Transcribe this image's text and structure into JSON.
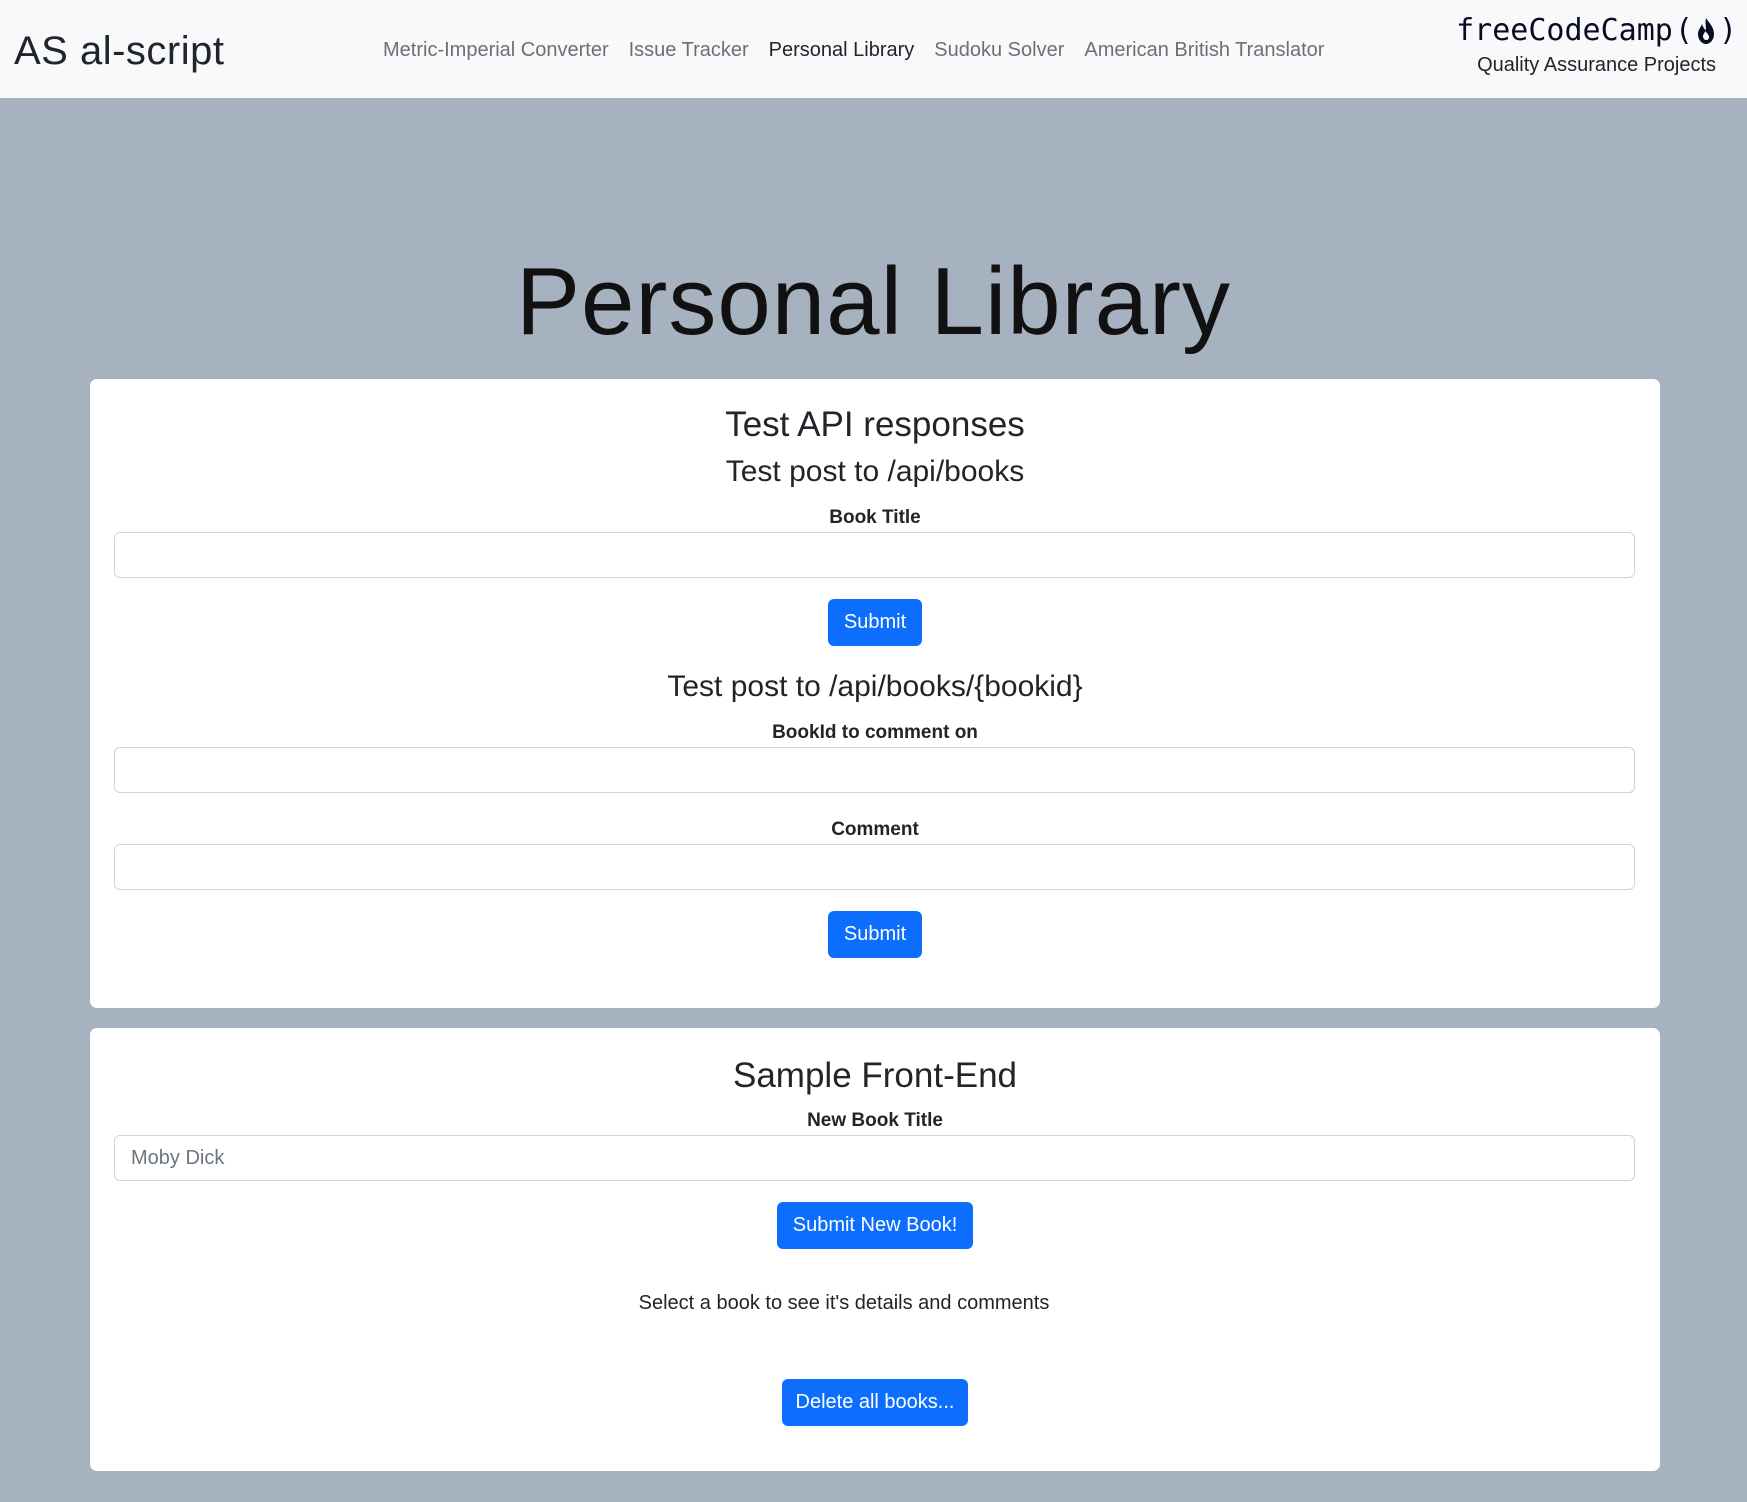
{
  "nav": {
    "brand": "AS al-script",
    "links": [
      {
        "label": "Metric-Imperial Converter",
        "active": false
      },
      {
        "label": "Issue Tracker",
        "active": false
      },
      {
        "label": "Personal Library",
        "active": true
      },
      {
        "label": "Sudoku Solver",
        "active": false
      },
      {
        "label": "American British Translator",
        "active": false
      }
    ],
    "fcc_logo": "freeCodeCamp",
    "fcc_paren_open": "(",
    "fcc_paren_close": ")",
    "fcc_icon": "flame-icon",
    "fcc_subtitle": "Quality Assurance Projects"
  },
  "hero": {
    "title": "Personal Library"
  },
  "api_test": {
    "title": "Test API responses",
    "post_books": {
      "title": "Test post to /api/books",
      "field_label": "Book Title",
      "field_value": "",
      "submit_label": "Submit"
    },
    "post_bookid": {
      "title": "Test post to /api/books/{bookid}",
      "bookid_label": "BookId to comment on",
      "bookid_value": "",
      "comment_label": "Comment",
      "comment_value": "",
      "submit_label": "Submit"
    }
  },
  "front_end": {
    "title": "Sample Front-End",
    "new_book_label": "New Book Title",
    "new_book_placeholder": "Moby Dick",
    "submit_label": "Submit New Book!",
    "info_text": "Select a book to see it's details and comments",
    "delete_label": "Delete all books..."
  },
  "colors": {
    "page_background": "#a7b2c0",
    "navbar_background": "#f8f9fa",
    "primary_button": "#0d6efd",
    "card_background": "#ffffff"
  }
}
